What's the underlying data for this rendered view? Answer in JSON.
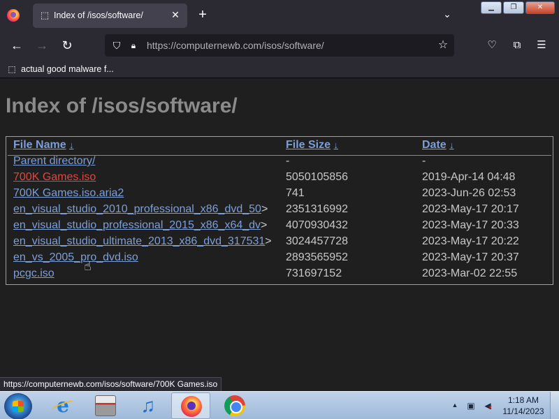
{
  "browser": {
    "tab_title": "Index of /isos/software/",
    "url_host": "https://computernewb.com",
    "url_path": "/isos/software/",
    "bookmark_label": "actual good malware f..."
  },
  "page": {
    "title": "Index of /isos/software/",
    "columns": {
      "name": "File Name",
      "size": "File Size",
      "date": "Date",
      "sort_arrow": "↓"
    },
    "rows": [
      {
        "name": "Parent directory/",
        "gt": "",
        "size": "-",
        "date": "-"
      },
      {
        "name": "700K Games.iso",
        "gt": "",
        "size": "5050105856",
        "date": "2019-Apr-14 04:48"
      },
      {
        "name": "700K Games.iso.aria2",
        "gt": "",
        "size": "741",
        "date": "2023-Jun-26 02:53"
      },
      {
        "name": "en_visual_studio_2010_professional_x86_dvd_50",
        "gt": ">",
        "size": "2351316992",
        "date": "2023-May-17 20:17"
      },
      {
        "name": "en_visual_studio_professional_2015_x86_x64_dv",
        "gt": ">",
        "size": "4070930432",
        "date": "2023-May-17 20:33"
      },
      {
        "name": "en_visual_studio_ultimate_2013_x86_dvd_317531",
        "gt": ">",
        "size": "3024457728",
        "date": "2023-May-17 20:22"
      },
      {
        "name": "en_vs_2005_pro_dvd.iso",
        "gt": "",
        "size": "2893565952",
        "date": "2023-May-17 20:37"
      },
      {
        "name": "pcgc.iso",
        "gt": "",
        "size": "731697152",
        "date": "2023-Mar-02 22:55"
      }
    ]
  },
  "status_bar_text": "https://computernewb.com/isos/software/700K Games.iso",
  "taskbar": {
    "time": "1:18 AM",
    "date": "11/14/2023"
  }
}
